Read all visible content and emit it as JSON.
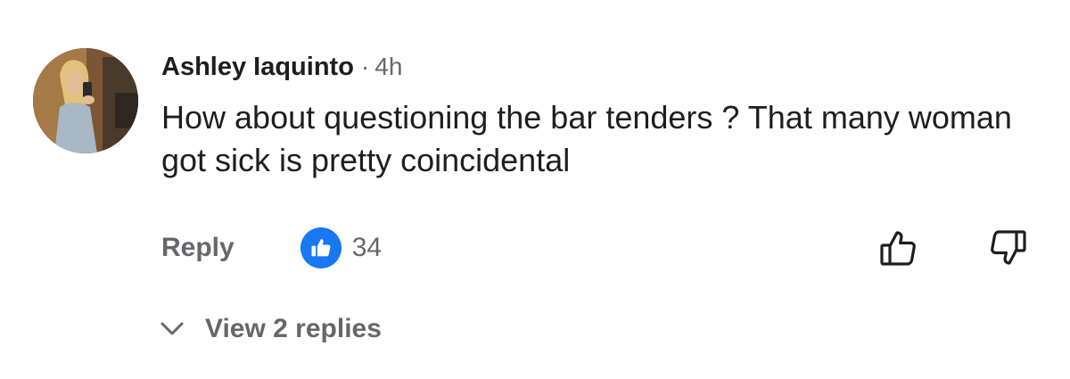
{
  "comment": {
    "author": "Ashley Iaquinto",
    "separator": "·",
    "time": "4h",
    "text": "How about questioning the bar tenders ? That many woman got sick is pretty coincidental",
    "avatar_icon": "profile-photo",
    "actions": {
      "reply_label": "Reply",
      "like_icon": "thumbs-up-icon",
      "like_count": "34",
      "upvote_icon": "thumbs-up-outline-icon",
      "downvote_icon": "thumbs-down-outline-icon"
    },
    "replies": {
      "label": "View 2 replies",
      "icon": "chevron-down-icon"
    }
  },
  "colors": {
    "text": "#1c1e21",
    "secondary": "#65676b",
    "accent": "#1877f2"
  }
}
